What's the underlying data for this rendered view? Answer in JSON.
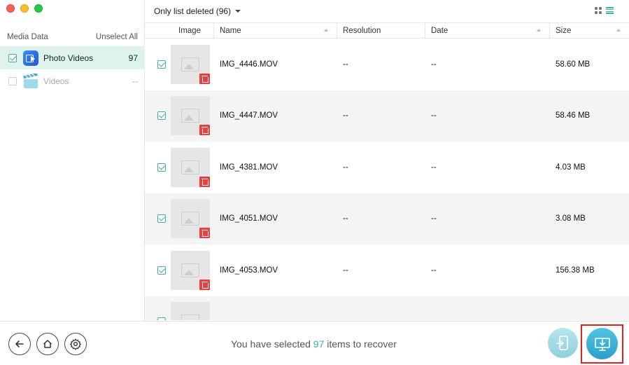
{
  "sidebar": {
    "header_label": "Media Data",
    "unselect_all": "Unselect All",
    "items": [
      {
        "label": "Photo Videos",
        "count": "97",
        "checked": true,
        "icon": "photo-videos-icon"
      },
      {
        "label": "Videos",
        "count": "--",
        "checked": false,
        "icon": "videos-clapperboard-icon"
      }
    ]
  },
  "toolbar": {
    "filter_label": "Only list deleted (96)",
    "view_modes": [
      "grid-view-icon",
      "list-view-icon"
    ]
  },
  "table": {
    "columns": [
      "Image",
      "Name",
      "Resolution",
      "Date",
      "Size"
    ],
    "rows": [
      {
        "name": "IMG_4446.MOV",
        "resolution": "--",
        "date": "--",
        "size": "58.60 MB"
      },
      {
        "name": "IMG_4447.MOV",
        "resolution": "--",
        "date": "--",
        "size": "58.46 MB"
      },
      {
        "name": "IMG_4381.MOV",
        "resolution": "--",
        "date": "--",
        "size": "4.03 MB"
      },
      {
        "name": "IMG_4051.MOV",
        "resolution": "--",
        "date": "--",
        "size": "3.08 MB"
      },
      {
        "name": "IMG_4053.MOV",
        "resolution": "--",
        "date": "--",
        "size": "156.38 MB"
      },
      {
        "name": "",
        "resolution": "",
        "date": "",
        "size": ""
      }
    ]
  },
  "footer": {
    "status_prefix": "You have selected ",
    "status_count": "97",
    "status_suffix": " items to recover"
  },
  "colors": {
    "accent": "#3fb29a",
    "selected_row": "#dff3ee",
    "trash_badge": "#e84040",
    "highlight": "#e52020",
    "to_pc_button": "#2a9fcb"
  }
}
